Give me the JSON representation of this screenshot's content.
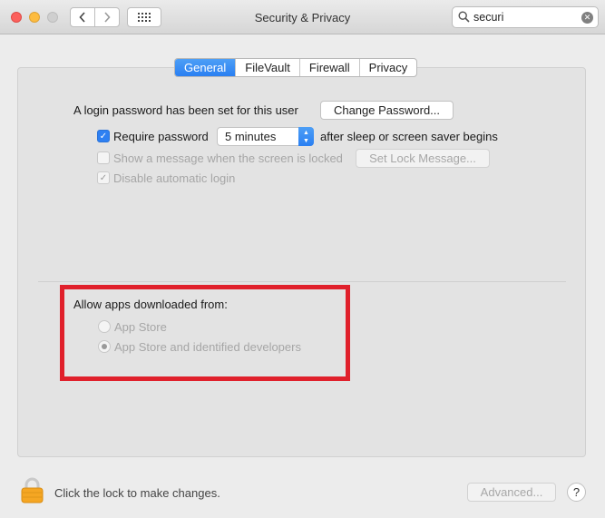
{
  "window": {
    "title": "Security & Privacy",
    "search_value": "securi"
  },
  "tabs": [
    {
      "label": "General",
      "active": true
    },
    {
      "label": "FileVault",
      "active": false
    },
    {
      "label": "Firewall",
      "active": false
    },
    {
      "label": "Privacy",
      "active": false
    }
  ],
  "general": {
    "login_password_text": "A login password has been set for this user",
    "change_password_label": "Change Password...",
    "require_password": {
      "label": "Require password",
      "checked": true,
      "interval": "5 minutes",
      "suffix": "after sleep or screen saver begins"
    },
    "show_message": {
      "label": "Show a message when the screen is locked",
      "checked": false,
      "enabled": false
    },
    "set_lock_message_label": "Set Lock Message...",
    "disable_auto_login": {
      "label": "Disable automatic login",
      "checked": true,
      "enabled": false
    }
  },
  "allow_apps": {
    "heading": "Allow apps downloaded from:",
    "options": [
      {
        "label": "App Store",
        "selected": false
      },
      {
        "label": "App Store and identified developers",
        "selected": true
      }
    ]
  },
  "footer": {
    "lock_text": "Click the lock to make changes.",
    "advanced_label": "Advanced...",
    "help_label": "?"
  },
  "colors": {
    "accent": "#2e80f2",
    "highlight": "#e0202b",
    "lock": "#f5a623"
  },
  "icons": {
    "back": "chevron-left-icon",
    "forward": "chevron-right-icon",
    "grid": "grid-icon",
    "search": "search-icon",
    "clear": "clear-icon",
    "lock": "lock-icon"
  }
}
